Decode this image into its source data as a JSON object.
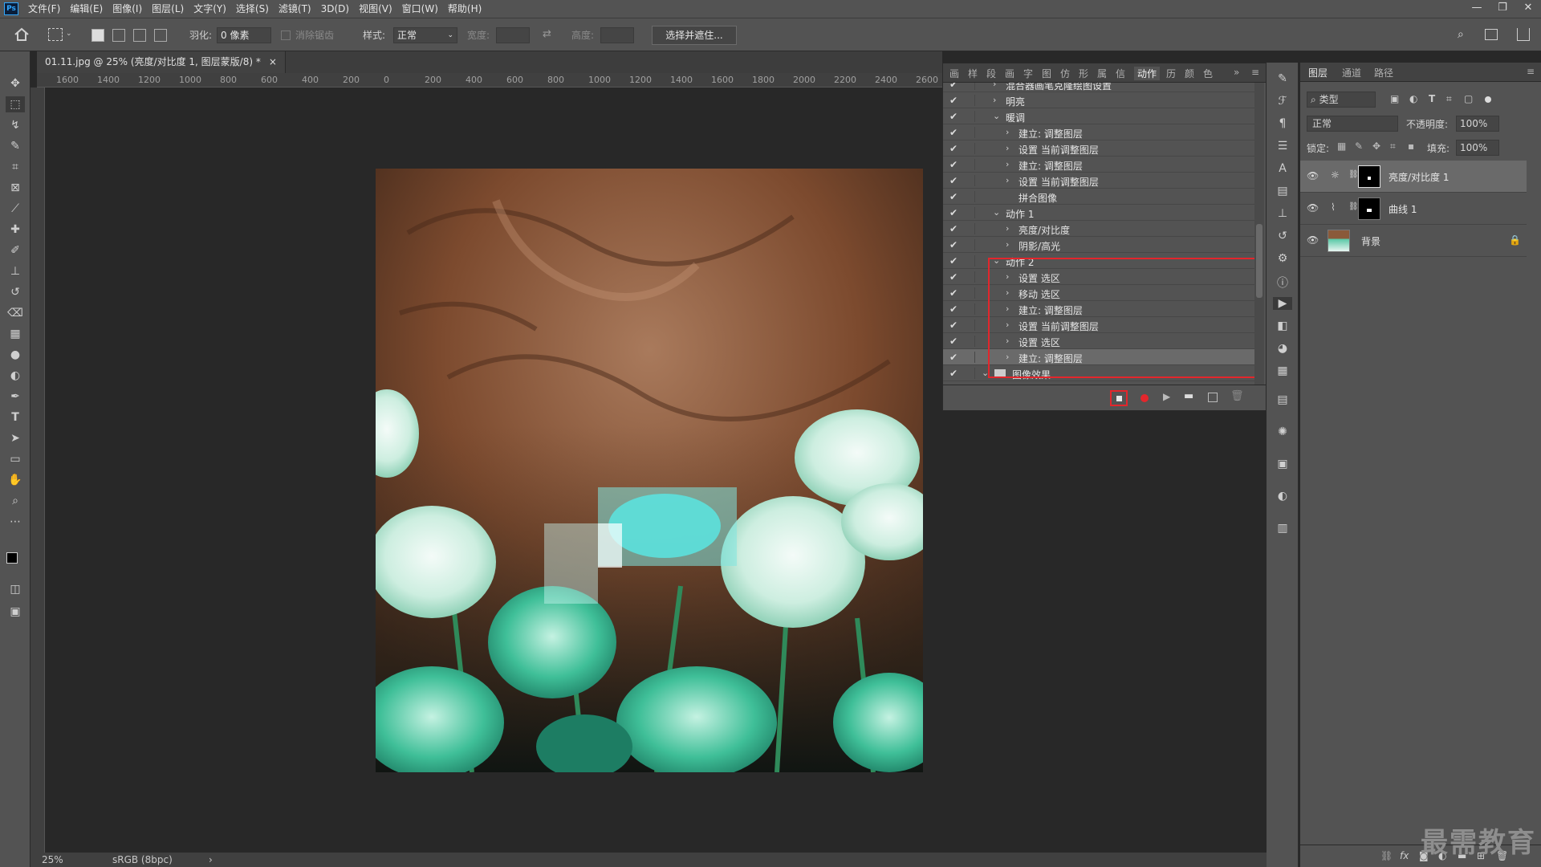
{
  "menubar": {
    "logo": "Ps",
    "items": [
      "文件(F)",
      "编辑(E)",
      "图像(I)",
      "图层(L)",
      "文字(Y)",
      "选择(S)",
      "滤镜(T)",
      "3D(D)",
      "视图(V)",
      "窗口(W)",
      "帮助(H)"
    ]
  },
  "window_controls": {
    "minimize": "—",
    "restore": "❐",
    "close": "✕"
  },
  "options": {
    "feather_label": "羽化:",
    "feather_value": "0 像素",
    "antialias_label": "消除锯齿",
    "style_label": "样式:",
    "style_value": "正常",
    "width_label": "宽度:",
    "height_label": "高度:",
    "select_mask_button": "选择并遮住..."
  },
  "document": {
    "tab_title": "01.11.jpg @ 25% (亮度/对比度 1, 图层蒙版/8) *",
    "close": "×"
  },
  "ruler_ticks": [
    "1600",
    "1400",
    "1200",
    "1000",
    "800",
    "600",
    "400",
    "200",
    "0",
    "200",
    "400",
    "600",
    "800",
    "1000",
    "1200",
    "1400",
    "1600",
    "1800",
    "2000",
    "2200",
    "2400",
    "2600"
  ],
  "actions_panel": {
    "tabs": [
      "画",
      "样",
      "段",
      "画",
      "字",
      "图",
      "仿",
      "形",
      "属",
      "信",
      "动作",
      "历",
      "颜",
      "色"
    ],
    "active_tab": "动作",
    "rows": [
      {
        "level": 1,
        "twisty": "›",
        "label": "混合器画笔克隆绘图设置"
      },
      {
        "level": 1,
        "twisty": "›",
        "label": "明亮"
      },
      {
        "level": 1,
        "twisty": "⌄",
        "label": "暖调"
      },
      {
        "level": 2,
        "twisty": "›",
        "label": "建立: 调整图层"
      },
      {
        "level": 2,
        "twisty": "›",
        "label": "设置 当前调整图层"
      },
      {
        "level": 2,
        "twisty": "›",
        "label": "建立: 调整图层"
      },
      {
        "level": 2,
        "twisty": "›",
        "label": "设置 当前调整图层"
      },
      {
        "level": 2,
        "twisty": "",
        "label": "拼合图像"
      },
      {
        "level": 1,
        "twisty": "⌄",
        "label": "动作 1"
      },
      {
        "level": 2,
        "twisty": "›",
        "label": "亮度/对比度"
      },
      {
        "level": 2,
        "twisty": "›",
        "label": "阴影/高光"
      },
      {
        "level": 1,
        "twisty": "⌄",
        "label": "动作 2"
      },
      {
        "level": 2,
        "twisty": "›",
        "label": "设置 选区"
      },
      {
        "level": 2,
        "twisty": "›",
        "label": "移动 选区"
      },
      {
        "level": 2,
        "twisty": "›",
        "label": "建立: 调整图层"
      },
      {
        "level": 2,
        "twisty": "›",
        "label": "设置 当前调整图层"
      },
      {
        "level": 2,
        "twisty": "›",
        "label": "设置 选区"
      },
      {
        "level": 2,
        "twisty": "›",
        "label": "建立: 调整图层"
      },
      {
        "level": 0,
        "twisty": "⌄",
        "label": "图像效果"
      }
    ],
    "footer_icons": [
      "stop-icon",
      "record-icon",
      "play-icon",
      "folder-icon",
      "new-action-icon",
      "trash-icon"
    ]
  },
  "layers_panel": {
    "tabs": [
      "图层",
      "通道",
      "路径"
    ],
    "filter_label": "类型",
    "blend_mode": "正常",
    "opacity_label": "不透明度:",
    "opacity_value": "100%",
    "lock_label": "锁定:",
    "fill_label": "填充:",
    "fill_value": "100%",
    "layers": [
      {
        "name": "亮度/对比度 1",
        "type": "adjustment"
      },
      {
        "name": "曲线 1",
        "type": "adjustment"
      },
      {
        "name": "背景",
        "type": "image"
      }
    ]
  },
  "status": {
    "zoom": "25%",
    "profile": "sRGB (8bpc)",
    "arrow": "›"
  },
  "watermark": "最需教育",
  "colors": {
    "highlight_red": "#e3262c",
    "record_red": "#e3262c"
  }
}
